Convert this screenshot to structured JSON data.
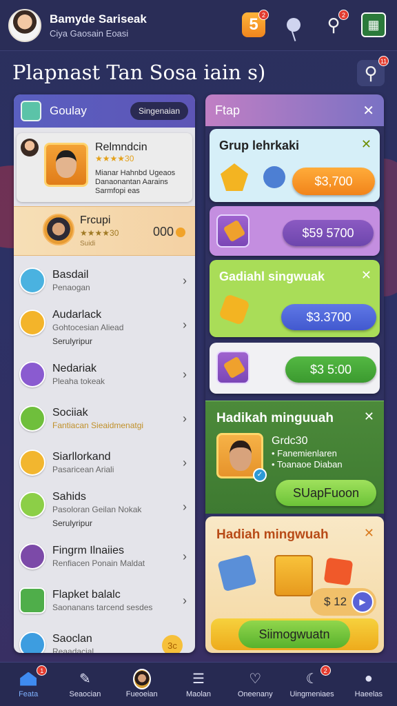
{
  "header": {
    "user_name": "Bamyde Sariseak",
    "user_subtitle": "Ciya Gaosain Eoasi",
    "coin_badge": "5",
    "coin_notify": "2",
    "search_notify": "2"
  },
  "page_title": "Plapnast Tan Sosa iain s)",
  "title_search_badge": "11",
  "left_panel": {
    "header_title": "Goulay",
    "header_pill": "Singenaian",
    "featured_1": {
      "name": "Relmndcin",
      "score": "★★★★30",
      "lines": [
        "Mianar Hahnbd Ugeaos",
        "Danaonantan Aarains",
        "Sarmfopi eas"
      ]
    },
    "featured_2": {
      "name": "Frcupi",
      "score": "★★★★30",
      "label": "Suidi",
      "value": "000"
    },
    "items": [
      {
        "label": "Basdail",
        "sub": "Penaogan",
        "extra": ""
      },
      {
        "label": "Audarlack",
        "sub": "Gohtocesian Aliead",
        "extra": "Serulyripur"
      },
      {
        "label": "Nedariak",
        "sub": "Pleaha tokeak",
        "extra": ""
      },
      {
        "label": "Sociiak",
        "sub": "Fantiacan Sieaidmenatgi",
        "extra": ""
      },
      {
        "label": "Siarllorkand",
        "sub": "Pasaricean Ariali",
        "extra": ""
      },
      {
        "label": "Sahids",
        "sub": "Pasoloran Geilan Nokak",
        "extra": "Serulyripur"
      },
      {
        "label": "Fingrm Ilnaiies",
        "sub": "Renfiacen Ponain Maldat",
        "extra": ""
      },
      {
        "label": "Flapket balalc",
        "sub": "Saonanans tarcend sesdes",
        "extra": ""
      },
      {
        "label": "Saoclan",
        "sub": "Reaadacial",
        "extra": ""
      }
    ],
    "bottom_coin": "3c"
  },
  "right_panel": {
    "header_title": "Ftap",
    "cards": [
      {
        "title": "Grup lehrkaki",
        "price": "$3,700"
      },
      {
        "title": "",
        "price": "$59 5700"
      },
      {
        "title": "Gadiahl singwuak",
        "price": "$3.3700"
      },
      {
        "title": "",
        "price": "$3 5:00"
      }
    ],
    "weekly_1": {
      "title": "Hadikah minguuah",
      "grade": "Grdc30",
      "bullets": [
        "• Fanemienlaren",
        "• Toanaoe Diaban"
      ],
      "button": "SUapFuoon"
    },
    "weekly_2": {
      "title": "Hadiah mingwuah",
      "prize": "$ 12",
      "button": "Siimogwuatn"
    }
  },
  "nav": [
    {
      "label": "Feata",
      "badge": "1",
      "active": true
    },
    {
      "label": "Seaocian",
      "badge": "",
      "active": false
    },
    {
      "label": "Fueoeian",
      "badge": "",
      "active": false
    },
    {
      "label": "Maolan",
      "badge": "",
      "active": false
    },
    {
      "label": "Oneenany",
      "badge": "",
      "active": false
    },
    {
      "label": "Uingmeniaes",
      "badge": "2",
      "active": false
    },
    {
      "label": "Haeelas",
      "badge": "",
      "active": false
    }
  ],
  "colors": {
    "accent_blue": "#4f63d8",
    "card_blue": "#d4eef7",
    "card_purple": "#c08ce0",
    "card_green": "#a6dd54",
    "orange_button": "#f58d1d",
    "green_button": "#43a63a"
  }
}
